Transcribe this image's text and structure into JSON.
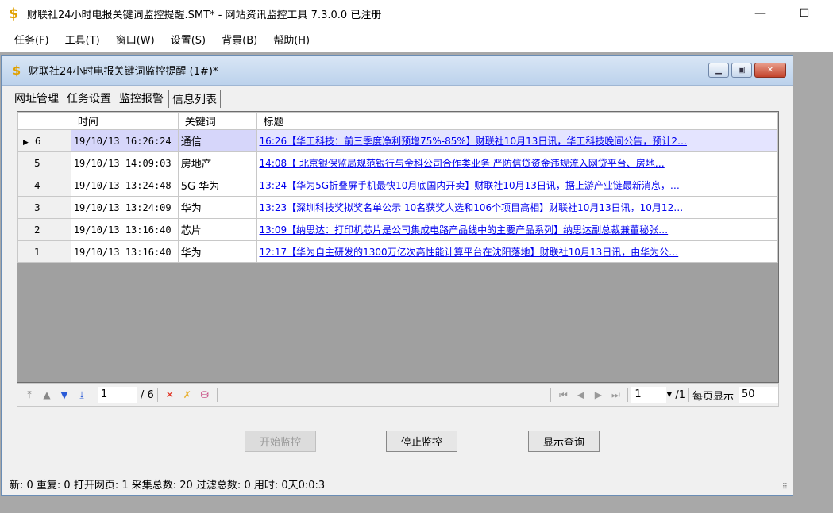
{
  "window": {
    "title": "财联社24小时电报关键词监控提醒.SMT* - 网站资讯监控工具 7.3.0.0 已注册",
    "minimize": "—",
    "maximize": "☐"
  },
  "menu": [
    "任务(F)",
    "工具(T)",
    "窗口(W)",
    "设置(S)",
    "背景(B)",
    "帮助(H)"
  ],
  "child": {
    "title": "财联社24小时电报关键词监控提醒  (1#)*",
    "tabs": [
      "网址管理",
      "任务设置",
      "监控报警",
      "信息列表"
    ],
    "active_tab": "信息列表"
  },
  "grid": {
    "columns": [
      "时间",
      "关键词",
      "标题"
    ],
    "rows": [
      {
        "id": "6",
        "time": "19/10/13 16:26:24",
        "keyword": "通信",
        "title": "16:26【华工科技：前三季度净利预增75%-85%】财联社10月13日讯，华工科技晚间公告，预计2…",
        "selected": true
      },
      {
        "id": "5",
        "time": "19/10/13 14:09:03",
        "keyword": "房地产",
        "title": "14:08【 北京银保监局规范银行与金科公司合作类业务 严防信贷资金违规流入网贷平台、房地…"
      },
      {
        "id": "4",
        "time": "19/10/13 13:24:48",
        "keyword": "5G 华为",
        "title": "13:24【华为5G折叠屏手机最快10月底国内开卖】财联社10月13日讯，据上游产业链最新消息，…"
      },
      {
        "id": "3",
        "time": "19/10/13 13:24:09",
        "keyword": "华为",
        "title": "13:23【深圳科技奖拟奖名单公示 10名获奖人选和106个项目高相】财联社10月13日讯，10月12…"
      },
      {
        "id": "2",
        "time": "19/10/13 13:16:40",
        "keyword": "芯片",
        "title": "13:09【纳思达：打印机芯片是公司集成电路产品线中的主要产品系列】纳思达副总裁兼董秘张…"
      },
      {
        "id": "1",
        "time": "19/10/13 13:16:40",
        "keyword": "华为",
        "title": "12:17【华为自主研发的1300万亿次高性能计算平台在沈阳落地】财联社10月13日讯，由华为公…"
      }
    ]
  },
  "navigator": {
    "record": "1",
    "record_total": "/ 6",
    "page": "1",
    "page_total": "/1",
    "page_size_label": "每页显示",
    "page_size": "50"
  },
  "buttons": {
    "start": "开始监控",
    "stop": "停止监控",
    "query": "显示查询"
  },
  "status": "新: 0  重复: 0  打开网页: 1  采集总数: 20  过滤总数: 0  用时: 0天0:0:3"
}
